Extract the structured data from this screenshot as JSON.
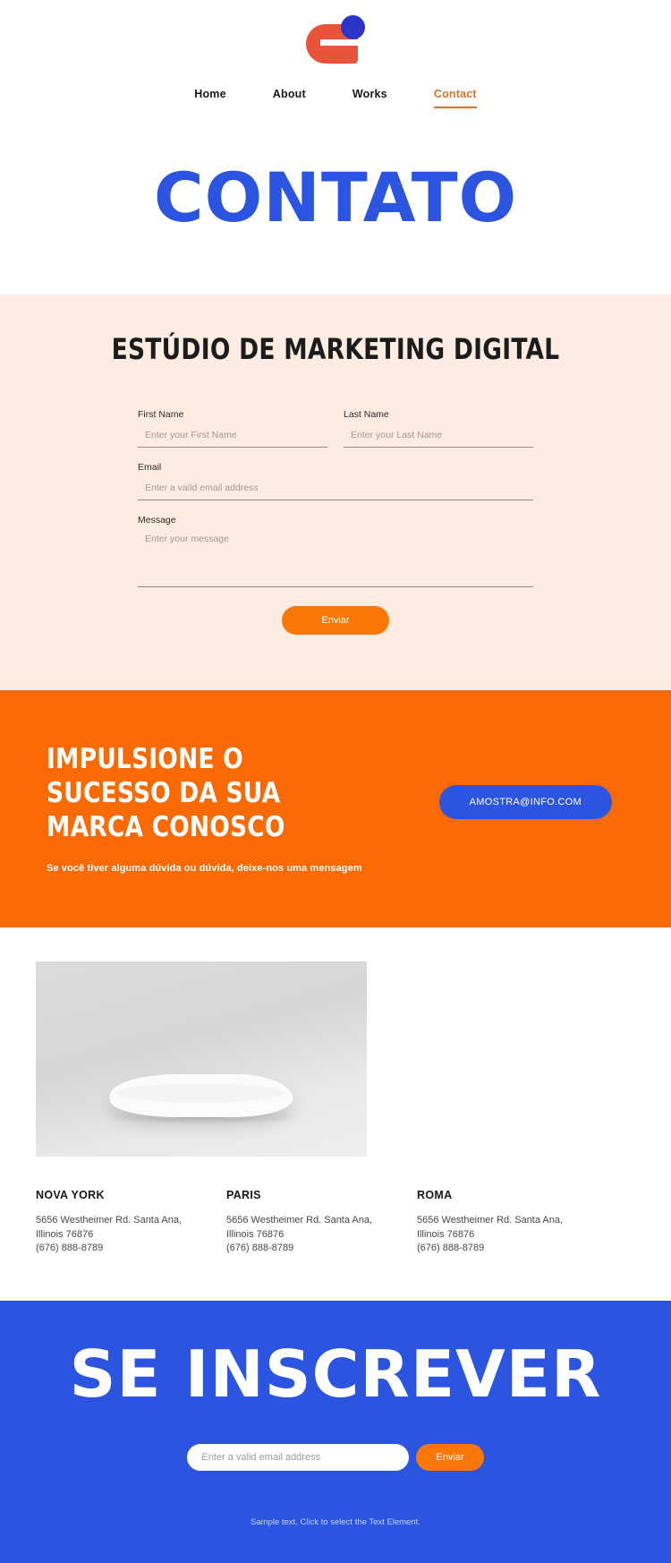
{
  "colors": {
    "brand_blue": "#2b55e0",
    "brand_orange": "#f96a05",
    "button_orange": "#f97706",
    "logo_red": "#e8533a",
    "logo_blue": "#2b35c8",
    "cream": "#fcece1",
    "nav_active": "#d2762a"
  },
  "header": {
    "logo_name": "brand-logo",
    "nav": [
      {
        "label": "Home",
        "active": false
      },
      {
        "label": "About",
        "active": false
      },
      {
        "label": "Works",
        "active": false
      },
      {
        "label": "Contact",
        "active": true
      }
    ]
  },
  "hero": {
    "title": "CONTATO"
  },
  "form_section": {
    "heading": "ESTÚDIO DE MARKETING DIGITAL",
    "fields": {
      "first_name": {
        "label": "First Name",
        "placeholder": "Enter your First Name",
        "value": ""
      },
      "last_name": {
        "label": "Last Name",
        "placeholder": "Enter your Last Name",
        "value": ""
      },
      "email": {
        "label": "Email",
        "placeholder": "Enter a valid email address",
        "value": ""
      },
      "message": {
        "label": "Message",
        "placeholder": "Enter your message",
        "value": ""
      }
    },
    "submit_label": "Enviar"
  },
  "cta": {
    "title_line1": "IMPULSIONE O",
    "title_line2": "SUCESSO DA SUA",
    "title_line3": "MARCA CONOSCO",
    "subtitle": "Se você tiver alguma dúvida ou dúvida, deixe-nos uma mensagem",
    "email_button": "AMOSTRA@INFO.COM"
  },
  "locations": {
    "image_alt": "white-rock-podium-photo",
    "items": [
      {
        "city": "NOVA YORK",
        "address": "5656 Westheimer Rd. Santa Ana, Illinois 76876",
        "phone": "(676) 888-8789"
      },
      {
        "city": "PARIS",
        "address": "5656 Westheimer Rd. Santa Ana, Illinois 76876",
        "phone": "(676) 888-8789"
      },
      {
        "city": "ROMA",
        "address": "5656 Westheimer Rd. Santa Ana, Illinois 76876",
        "phone": "(676) 888-8789"
      }
    ]
  },
  "subscribe": {
    "title": "SE INSCREVER",
    "email_placeholder": "Enter a valid email address",
    "email_value": "",
    "button_label": "Enviar",
    "footer_note": "Sample text. Click to select the Text Element."
  }
}
